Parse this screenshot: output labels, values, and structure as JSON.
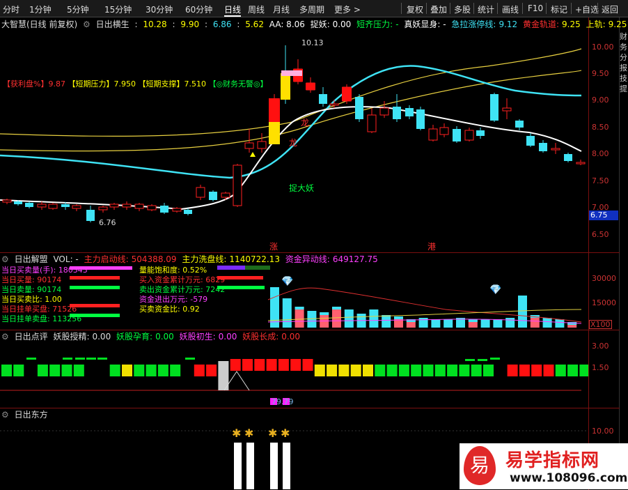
{
  "toolbar": {
    "left": [
      "分时",
      "1分钟",
      "5分钟",
      "15分钟",
      "30分钟",
      "60分钟",
      "日线",
      "周线",
      "月线",
      "多周期",
      "更多 >"
    ],
    "active": "日线",
    "right": [
      "复权",
      "叠加",
      "多股",
      "统计",
      "画线",
      "F10",
      "标记",
      "+自选",
      "返回"
    ]
  },
  "main": {
    "title": "大智慧(日线 前复权)",
    "indicator": "日出横生",
    "values": [
      "10.28",
      "9.90",
      "6.86",
      "5.62"
    ],
    "aa": "AA: 8.06",
    "zhuoyao": "捉妖: 0.00",
    "duanqi_label": "短齐压力:",
    "duanqi_val": "-",
    "zhenyao": "真妖显身: -",
    "jila": "急拉涨停线:",
    "jila_val": "9.12",
    "huangjin": "黄金轨道:",
    "huangjin_val": "9.25",
    "shanggui": "上轨:",
    "shanggui_val": "9.25",
    "legend": [
      "【获利盘%】",
      "9.87",
      "【短期压力】",
      "7.950",
      "【短期支撑】",
      "7.510",
      "【◎财务无警◎】"
    ],
    "high_label": "10.13",
    "low_label": "6.76",
    "price_tag": "6.75",
    "ticks": [
      "10.00",
      "9.50",
      "9.00",
      "8.50",
      "8.00",
      "7.50",
      "7.00",
      "6.50"
    ],
    "text_long": "龙",
    "text_long2": "龙",
    "text_zhuo": "捉大妖",
    "text_zhang": "涨",
    "text_gang": "港",
    "right_vertical": "财务 分 报 技 提"
  },
  "vol": {
    "title": "日出解盟",
    "vol_label": "VOL: -",
    "zhuli_label": "主力启动线:",
    "zhuli_val": "504388.09",
    "xipan_label": "主力洗盘线:",
    "xipan_val": "1140722.13",
    "zijin_label": "资金异动线:",
    "zijin_val": "649127.75",
    "left_info": [
      {
        "label": "当日买卖量(手):",
        "val": "180343"
      },
      {
        "label": "当日买量:",
        "val": "90174"
      },
      {
        "label": "当日卖量:",
        "val": "90174"
      },
      {
        "label": "当日买卖比:",
        "val": "1.00"
      },
      {
        "label": "当日挂单买盘:",
        "val": "71526"
      },
      {
        "label": "当日挂单卖盘:",
        "val": "113256"
      }
    ],
    "mid_info": [
      {
        "label": "量能饱和度:",
        "val": "0.52%"
      },
      {
        "label": "买入资金累计万元:",
        "val": "6829"
      },
      {
        "label": "卖出资金累计万元:",
        "val": "7242"
      },
      {
        "label": "资金进出万元:",
        "val": "-579"
      },
      {
        "label": "买卖资金比:",
        "val": "0.92"
      }
    ],
    "ticks": [
      "30000",
      "15000"
    ],
    "unit": "X100"
  },
  "score": {
    "title": "日出点评",
    "items": [
      {
        "label": "妖股授精:",
        "val": "0.00"
      },
      {
        "label": "妖股孕育:",
        "val": "0.00"
      },
      {
        "label": "妖股初生:",
        "val": "0.00"
      },
      {
        "label": "妖股长成:",
        "val": "0.00"
      }
    ],
    "ticks": [
      "3.00",
      "1.50"
    ],
    "bottom_val": "79.79"
  },
  "east": {
    "title": "日出东方",
    "ticks": [
      "10.00"
    ]
  },
  "watermark": {
    "icon": "易",
    "brand": "易学指标网",
    "url": "www.108096.com"
  },
  "colors": {
    "up": "#ff2020",
    "down": "#3fe3f5",
    "yellow": "#ffff00",
    "magenta": "#ff40ff",
    "green": "#00ff40"
  }
}
